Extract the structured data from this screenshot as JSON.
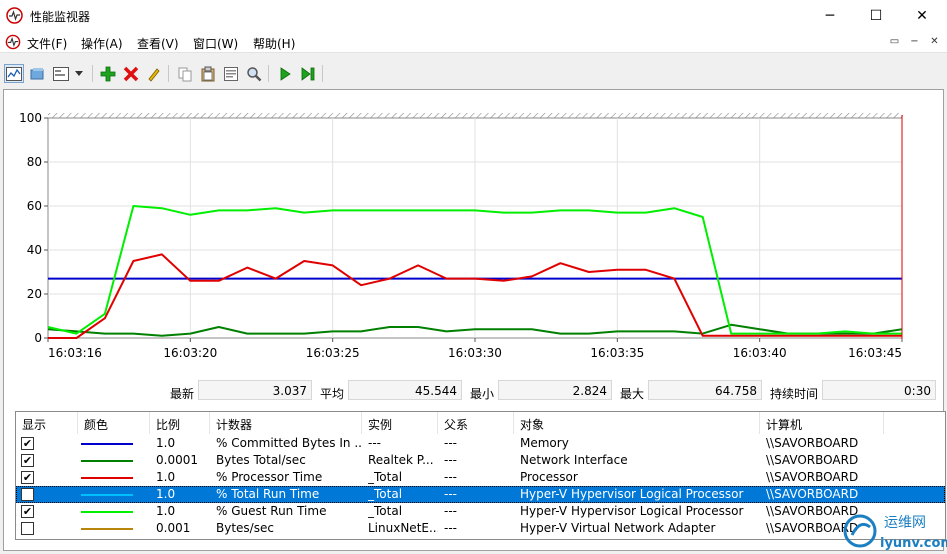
{
  "window": {
    "title": "性能监视器",
    "minimize_glyph": "─",
    "maximize_glyph": "☐",
    "close_glyph": "✕"
  },
  "menu": [
    "文件(F)",
    "操作(A)",
    "查看(V)",
    "窗口(W)",
    "帮助(H)"
  ],
  "mdi_buttons": [
    "▭",
    "−",
    "❐",
    "✕"
  ],
  "toolbar": {
    "icons": [
      "view-graph-icon",
      "view-histogram-icon",
      "view-report-icon",
      "dropdown-arrow-icon",
      "add-counter-icon",
      "delete-counter-icon",
      "highlight-icon",
      "copy-properties-icon",
      "paste-counter-list-icon",
      "properties-icon",
      "zoom-icon",
      "unfreeze-display-icon",
      "update-data-icon"
    ]
  },
  "chart_data": {
    "type": "line",
    "ylim": [
      0,
      100
    ],
    "yticks": [
      "100",
      "80",
      "60",
      "40",
      "20",
      "0"
    ],
    "xticks": [
      "16:03:16",
      "16:03:20",
      "16:03:25",
      "16:03:30",
      "16:03:35",
      "16:03:40",
      "16:03:45"
    ],
    "samples": 31,
    "grid": true,
    "series": [
      {
        "name": "% Committed Bytes In Use",
        "color": "#0000cc",
        "values": [
          27,
          27,
          27,
          27,
          27,
          27,
          27,
          27,
          27,
          27,
          27,
          27,
          27,
          27,
          27,
          27,
          27,
          27,
          27,
          27,
          27,
          27,
          27,
          27,
          27,
          27,
          27,
          27,
          27,
          27,
          27
        ]
      },
      {
        "name": "Bytes Total/sec",
        "color": "#008000",
        "values": [
          4,
          3,
          2,
          2,
          1,
          2,
          5,
          2,
          2,
          2,
          3,
          3,
          5,
          5,
          3,
          4,
          4,
          4,
          2,
          2,
          3,
          3,
          3,
          2,
          6,
          4,
          2,
          2,
          2,
          2,
          4
        ]
      },
      {
        "name": "% Processor Time",
        "color": "#e00000",
        "values": [
          0,
          0,
          9,
          35,
          38,
          26,
          26,
          32,
          27,
          35,
          33,
          24,
          27,
          33,
          27,
          27,
          26,
          28,
          34,
          30,
          31,
          31,
          27,
          1,
          1,
          1,
          1,
          1,
          1,
          1,
          1
        ]
      },
      {
        "name": "% Guest Run Time",
        "color": "#00ee00",
        "values": [
          5,
          2,
          11,
          60,
          59,
          56,
          58,
          58,
          59,
          57,
          58,
          58,
          58,
          58,
          58,
          58,
          57,
          57,
          58,
          58,
          57,
          57,
          59,
          55,
          2,
          2,
          2,
          2,
          3,
          2,
          2
        ]
      }
    ]
  },
  "stats": {
    "last_label": "最新",
    "last_value": "3.037",
    "avg_label": "平均",
    "avg_value": "45.544",
    "min_label": "最小",
    "min_value": "2.824",
    "max_label": "最大",
    "max_value": "64.758",
    "duration_label": "持续时间",
    "duration_value": "0:30"
  },
  "legend": {
    "headers": [
      "显示",
      "颜色",
      "比例",
      "计数器",
      "实例",
      "父系",
      "对象",
      "计算机"
    ],
    "rows": [
      {
        "show": "✔",
        "color": "#0000cc",
        "scale": "1.0",
        "counter": "% Committed Bytes In ...",
        "instance": "---",
        "parent": "---",
        "object": "Memory",
        "computer": "\\\\SAVORBOARD",
        "selected": false
      },
      {
        "show": "✔",
        "color": "#008000",
        "scale": "0.0001",
        "counter": "Bytes Total/sec",
        "instance": "Realtek P...",
        "parent": "---",
        "object": "Network Interface",
        "computer": "\\\\SAVORBOARD",
        "selected": false
      },
      {
        "show": "✔",
        "color": "#e00000",
        "scale": "1.0",
        "counter": "% Processor Time",
        "instance": "_Total",
        "parent": "---",
        "object": "Processor",
        "computer": "\\\\SAVORBOARD",
        "selected": false
      },
      {
        "show": "",
        "color": "#00bfff",
        "scale": "1.0",
        "counter": "% Total Run Time",
        "instance": "_Total",
        "parent": "---",
        "object": "Hyper-V Hypervisor Logical Processor",
        "computer": "\\\\SAVORBOARD",
        "selected": true
      },
      {
        "show": "✔",
        "color": "#00ee00",
        "scale": "1.0",
        "counter": "% Guest Run Time",
        "instance": "_Total",
        "parent": "---",
        "object": "Hyper-V Hypervisor Logical Processor",
        "computer": "\\\\SAVORBOARD",
        "selected": false
      },
      {
        "show": "",
        "color": "#b8860b",
        "scale": "0.001",
        "counter": "Bytes/sec",
        "instance": "LinuxNetE...",
        "parent": "---",
        "object": "Hyper-V Virtual Network Adapter",
        "computer": "\\\\SAVORBOARD",
        "selected": false
      }
    ]
  },
  "watermark": {
    "text": "运维网",
    "url": "iyunv.com"
  }
}
